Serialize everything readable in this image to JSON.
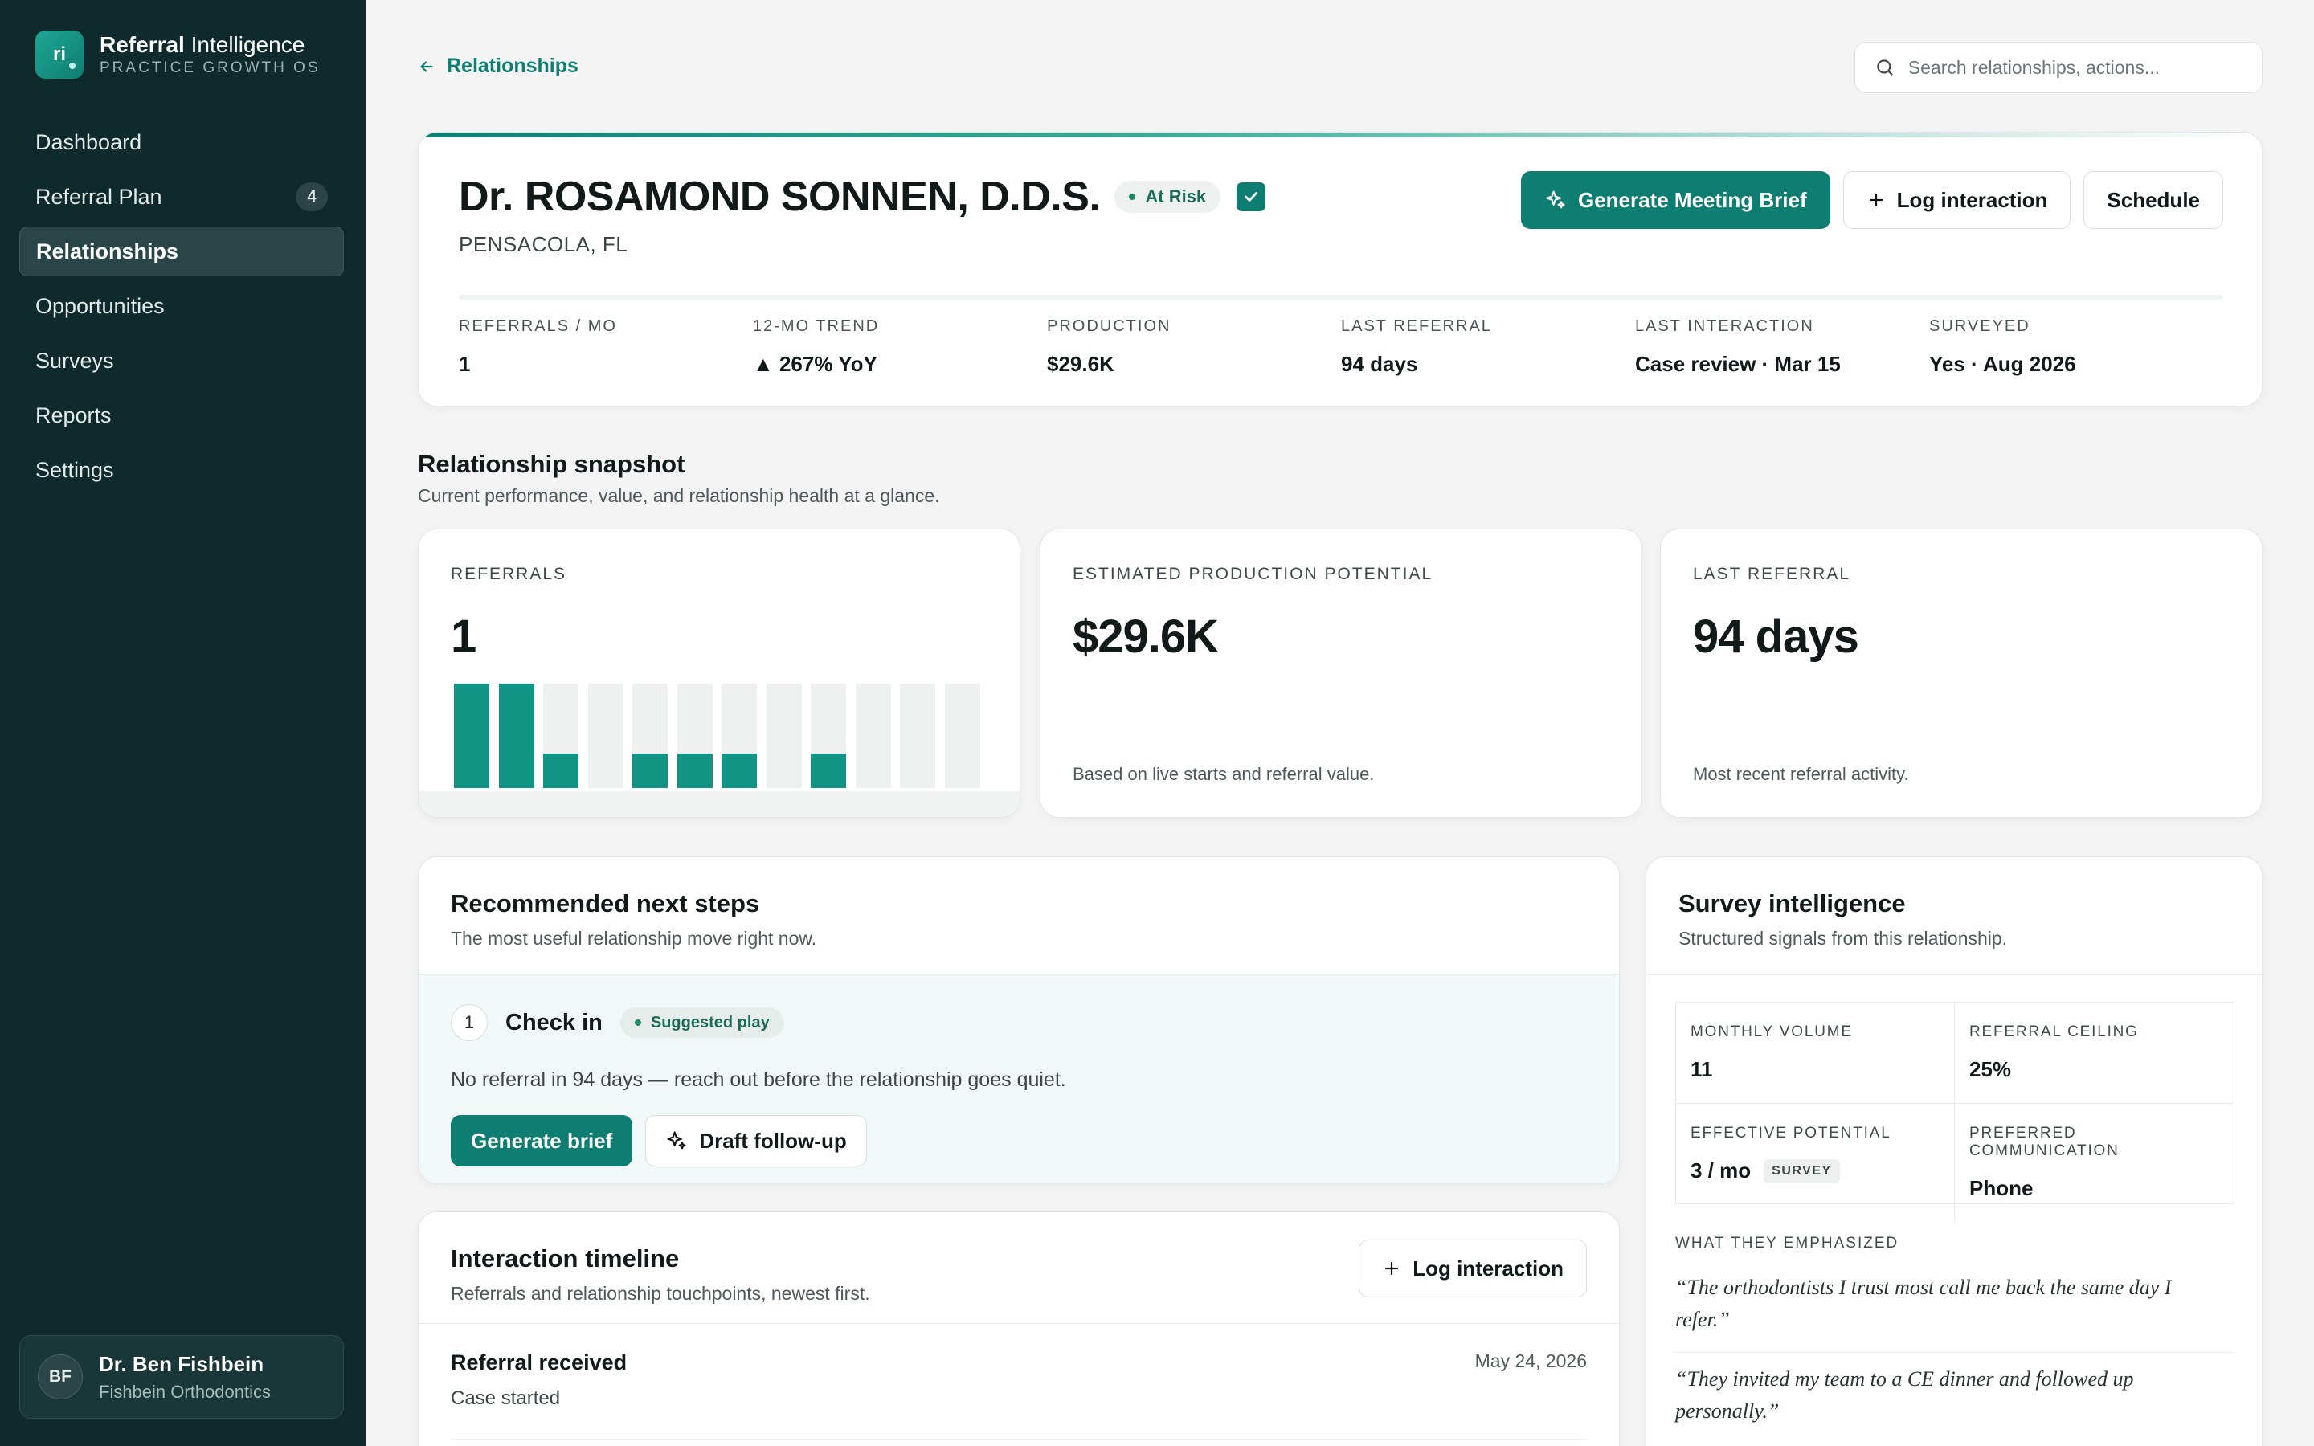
{
  "brand": {
    "logo_text": "ri",
    "title_bold": "Referral",
    "title_rest": " Intelligence",
    "subtitle": "PRACTICE GROWTH OS"
  },
  "nav": {
    "items": [
      {
        "label": "Dashboard"
      },
      {
        "label": "Referral Plan",
        "badge": "4"
      },
      {
        "label": "Relationships"
      },
      {
        "label": "Opportunities"
      },
      {
        "label": "Surveys"
      },
      {
        "label": "Reports"
      },
      {
        "label": "Settings"
      }
    ]
  },
  "user": {
    "initials": "BF",
    "name": "Dr. Ben Fishbein",
    "org": "Fishbein Orthodontics"
  },
  "back_link": "Relationships",
  "search": {
    "placeholder": "Search relationships, actions..."
  },
  "header": {
    "name": "Dr. ROSAMOND SONNEN, D.D.S.",
    "status": "At Risk",
    "location": "PENSACOLA, FL",
    "actions": {
      "brief": "Generate Meeting Brief",
      "log": "Log interaction",
      "schedule": "Schedule"
    },
    "stats": [
      {
        "label": "REFERRALS / MO",
        "value": "1"
      },
      {
        "label": "12-MO TREND",
        "value": "▲ 267% YoY"
      },
      {
        "label": "PRODUCTION",
        "value": "$29.6K"
      },
      {
        "label": "LAST REFERRAL",
        "value": "94 days"
      },
      {
        "label": "LAST INTERACTION",
        "value": "Case review · Mar 15"
      },
      {
        "label": "SURVEYED",
        "value": "Yes · Aug 2026"
      }
    ]
  },
  "snapshot": {
    "title": "Relationship snapshot",
    "subtitle": "Current performance, value, and relationship health at a glance.",
    "referrals": {
      "label": "REFERRALS",
      "value": "1",
      "monthly": [
        2,
        2,
        0.66,
        0,
        0.66,
        0.66,
        0.66,
        0,
        0.66,
        0,
        0,
        0
      ],
      "max": 2,
      "bar_color": "#129485"
    },
    "production": {
      "label": "ESTIMATED PRODUCTION POTENTIAL",
      "value": "$29.6K",
      "note": "Based on live starts and referral value."
    },
    "last_referral": {
      "label": "LAST REFERRAL",
      "value": "94 days",
      "note": "Most recent referral activity."
    }
  },
  "next_steps": {
    "title": "Recommended next steps",
    "subtitle": "The most useful relationship move right now.",
    "step": {
      "number": "1",
      "title": "Check in",
      "tag": "Suggested play",
      "description": "No referral in 94 days — reach out before the relationship goes quiet.",
      "primary": "Generate brief",
      "secondary": "Draft follow-up"
    }
  },
  "timeline": {
    "title": "Interaction timeline",
    "subtitle": "Referrals and relationship touchpoints, newest first.",
    "button": "Log interaction",
    "entries": [
      {
        "title": "Referral received",
        "detail": "Case started",
        "date": "May 24, 2026"
      }
    ]
  },
  "survey": {
    "title": "Survey intelligence",
    "subtitle": "Structured signals from this relationship.",
    "cells": [
      {
        "label": "MONTHLY VOLUME",
        "value": "11"
      },
      {
        "label": "REFERRAL CEILING",
        "value": "25%"
      },
      {
        "label": "EFFECTIVE POTENTIAL",
        "value": "3 / mo",
        "tag": "SURVEY"
      },
      {
        "label": "PREFERRED COMMUNICATION",
        "value": "Phone"
      }
    ],
    "emphasized_label": "WHAT THEY EMPHASIZED",
    "quotes": [
      "“The orthodontists I trust most call me back the same day I refer.”",
      "“They invited my team to a CE dinner and followed up personally.”"
    ]
  },
  "colors": {
    "sidebar": "#0e2a2d",
    "accent": "#0f7e72",
    "background": "#f3f4f3"
  }
}
